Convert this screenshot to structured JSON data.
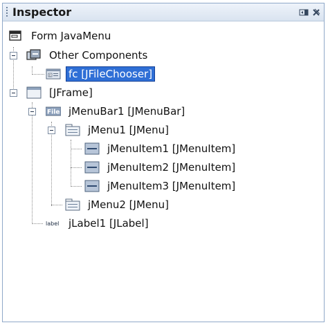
{
  "window": {
    "title": "Inspector"
  },
  "tree": {
    "form": "Form JavaMenu",
    "other_components": "Other Components",
    "fc": "fc [JFileChooser]",
    "jframe": "[JFrame]",
    "jmenubar1": "jMenuBar1 [JMenuBar]",
    "jmenu1": "jMenu1 [JMenu]",
    "jmenuitem1": "jMenuItem1 [JMenuItem]",
    "jmenuitem2": "jMenuItem2 [JMenuItem]",
    "jmenuitem3": "jMenuItem3 [JMenuItem]",
    "jmenu2": "jMenu2 [JMenu]",
    "jlabel1": "jLabel1 [JLabel]"
  },
  "icons": {
    "menubar_badge": "File",
    "label_badge": "label",
    "chooser_badge": "0"
  },
  "colors": {
    "selection": "#2f6fd6",
    "header": "#d9e3f0"
  }
}
